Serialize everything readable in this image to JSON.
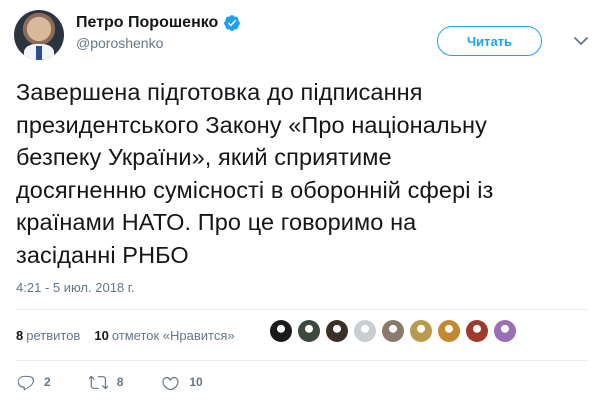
{
  "user": {
    "display_name": "Петро Порошенко",
    "handle": "@poroshenko",
    "verified_color": "#1da1f2"
  },
  "follow_button": {
    "label": "Читать"
  },
  "tweet": {
    "lines": [
      "Завершена підготовка до підписання",
      "президентського Закону «Про національну",
      "безпеку України», який сприятиме",
      "досягненню сумісності в оборонній сфері із",
      "країнами НАТО. Про це говоримо на",
      "засіданні РНБО"
    ],
    "timestamp": "4:21 - 5 июл. 2018 г."
  },
  "stats": {
    "retweets_count": "8",
    "retweets_label": "ретвитов",
    "likes_count": "10",
    "likes_label": "отметок «Нравится»"
  },
  "liker_avatar_colors": [
    "#1a1a1a",
    "#3b4a3c",
    "#3a3025",
    "#c9ced3",
    "#8a7a6a",
    "#b89a4a",
    "#c28a2e",
    "#a03a2c",
    "#9b6fb5"
  ],
  "actions": {
    "reply_count": "2",
    "retweet_count": "8",
    "like_count": "10"
  }
}
